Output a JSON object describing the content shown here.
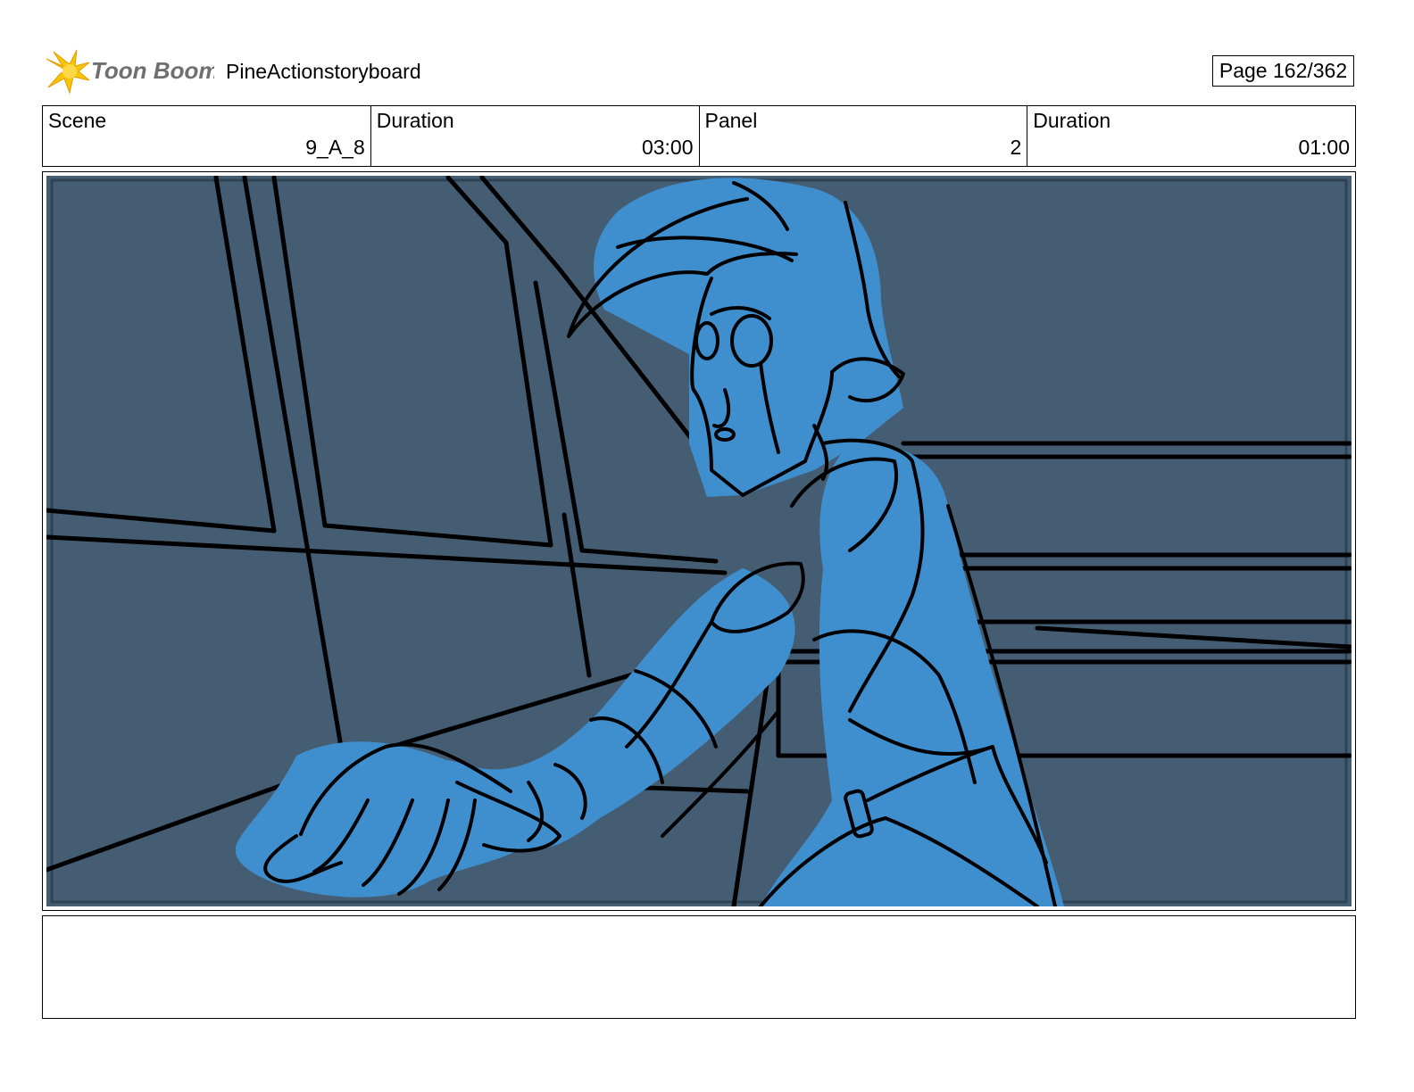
{
  "header": {
    "logo_text": "Toon Boom",
    "project_title": "PineActionstoryboard",
    "page_label": "Page 162/362"
  },
  "info": {
    "scene_label": "Scene",
    "scene_value": "9_A_8",
    "scene_duration_label": "Duration",
    "scene_duration_value": "03:00",
    "panel_label": "Panel",
    "panel_value": "2",
    "panel_duration_label": "Duration",
    "panel_duration_value": "01:00"
  },
  "colors": {
    "background_fill": "#455d73",
    "character_fill": "#3f8fcf",
    "line_ink": "#000000",
    "logo_star": "#f7c400",
    "logo_text": "#6f6f6f"
  },
  "panel": {
    "notes": ""
  }
}
